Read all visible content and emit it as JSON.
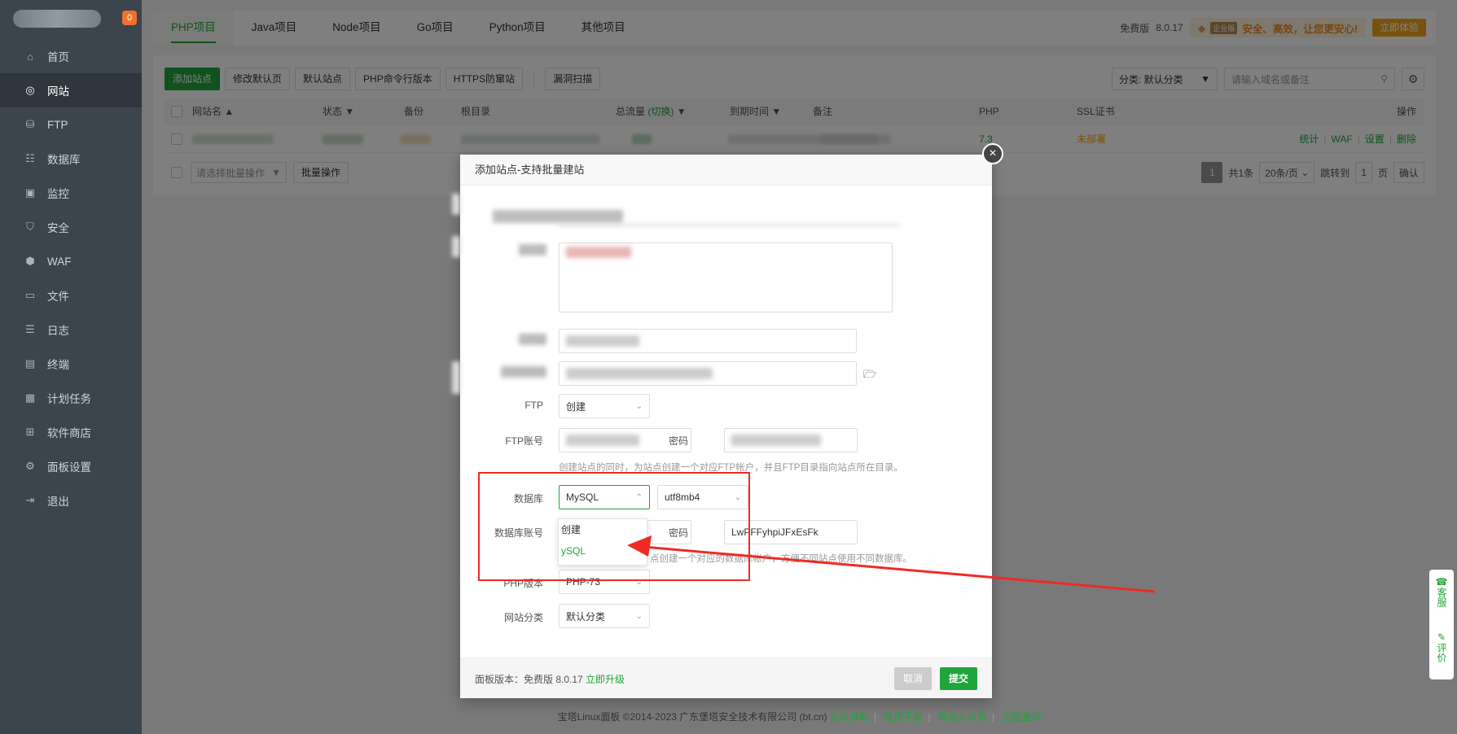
{
  "sidebar": {
    "badge": "0",
    "items": [
      {
        "icon": "home-icon",
        "glyph": "⌂",
        "label": "首页"
      },
      {
        "icon": "globe-icon",
        "glyph": "◎",
        "label": "网站"
      },
      {
        "icon": "ftp-icon",
        "glyph": "⛁",
        "label": "FTP"
      },
      {
        "icon": "database-icon",
        "glyph": "☷",
        "label": "数据库"
      },
      {
        "icon": "monitor-icon",
        "glyph": "▣",
        "label": "监控"
      },
      {
        "icon": "shield-icon",
        "glyph": "⛉",
        "label": "安全"
      },
      {
        "icon": "waf-icon",
        "glyph": "⬢",
        "label": "WAF"
      },
      {
        "icon": "folder-icon",
        "glyph": "▭",
        "label": "文件"
      },
      {
        "icon": "log-icon",
        "glyph": "☰",
        "label": "日志"
      },
      {
        "icon": "terminal-icon",
        "glyph": "▤",
        "label": "终端"
      },
      {
        "icon": "calendar-icon",
        "glyph": "▦",
        "label": "计划任务"
      },
      {
        "icon": "grid-icon",
        "glyph": "⊞",
        "label": "软件商店"
      },
      {
        "icon": "settings-icon",
        "glyph": "⚙",
        "label": "面板设置"
      },
      {
        "icon": "logout-icon",
        "glyph": "⇥",
        "label": "退出"
      }
    ],
    "active_index": 1
  },
  "tabs": [
    "PHP项目",
    "Java项目",
    "Node项目",
    "Go项目",
    "Python项目",
    "其他项目"
  ],
  "topbar": {
    "edition": "免费版",
    "version": "8.0.17",
    "promo_badge": "企业版",
    "promo_text": "安全、高效，让您更安心!",
    "try_button": "立即体验"
  },
  "toolbar": {
    "add_site": "添加站点",
    "edit_default_page": "修改默认页",
    "default_site": "默认站点",
    "php_cli": "PHP命令行版本",
    "https_guard": "HTTPS防窜站",
    "vuln_scan": "漏洞扫描",
    "category_select": "分类: 默认分类",
    "search_placeholder": "请输入域名或备注"
  },
  "table": {
    "headers": {
      "name": "网站名",
      "status": "状态",
      "backup": "备份",
      "root": "根目录",
      "traffic": "总流量",
      "traffic_switch": "(切换)",
      "expire": "到期时间",
      "remark": "备注",
      "php": "PHP",
      "ssl": "SSL证书",
      "ops": "操作"
    },
    "row": {
      "php": "7.3",
      "ssl": "未部署",
      "op_stats": "统计",
      "op_waf": "WAF",
      "op_settings": "设置",
      "op_delete": "删除"
    },
    "batch_placeholder": "请选择批量操作",
    "batch_button": "批量操作",
    "pager": {
      "current": "1",
      "total": "共1条",
      "per_page": "20条/页",
      "jump_label": "跳转到",
      "jump_value": "1",
      "page_unit": "页",
      "confirm": "确认"
    }
  },
  "dialog": {
    "title": "添加站点-支持批量建站",
    "ftp_label": "FTP",
    "ftp_value": "创建",
    "ftp_account_label": "FTP账号",
    "ftp_password_label": "密码",
    "ftp_help": "创建站点的同时，为站点创建一个对应FTP帐户，并且FTP目录指向站点所在目录。",
    "db_label": "数据库",
    "db_value": "MySQL",
    "db_charset": "utf8mb4",
    "db_account_label": "数据库账号",
    "db_password_label": "密码",
    "db_password_value": "LwPFFyhpiJFxEsFk",
    "db_help": "点创建一个对应的数据库帐户，方便不同站点使用不同数据库。",
    "db_options": [
      "不创建",
      "MySQL"
    ],
    "db_options_visible": [
      "创建",
      "ySQL"
    ],
    "php_label": "PHP版本",
    "php_value": "PHP-73",
    "category_label": "网站分类",
    "category_value": "默认分类",
    "footer_version": "面板版本：免费版 8.0.17",
    "footer_upgrade": "立即升级",
    "cancel": "取消",
    "submit": "提交"
  },
  "page_footer": {
    "copyright": "宝塔Linux面板 ©2014-2023 广东堡塔安全技术有限公司 (bt.cn)",
    "forum": "论坛求助",
    "manual": "使用手册",
    "wechat": "微信公众号",
    "verify": "正版查询"
  },
  "float_widget": {
    "service": "客服",
    "review": "评价"
  },
  "colors": {
    "brand_green": "#20a53a",
    "sidebar_bg": "#3c444d",
    "annotation_red": "#ee2b24",
    "warning_orange": "#f0a51a"
  }
}
